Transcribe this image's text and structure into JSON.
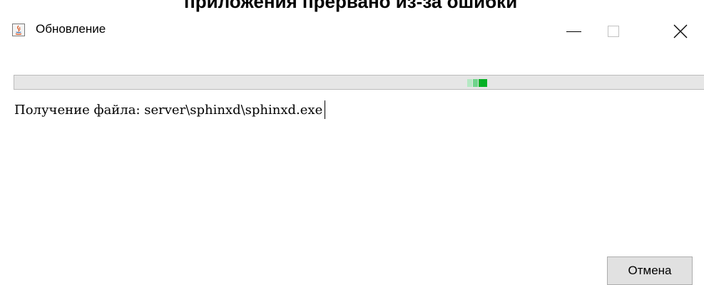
{
  "top_strip_text": "приложения прервано из-за ошибки",
  "window": {
    "title": "Обновление",
    "icon": "java-icon",
    "controls": [
      "minimize-icon",
      "maximize-icon",
      "close-icon"
    ]
  },
  "progress": {
    "indeterminate": true,
    "color": "#06b025"
  },
  "status": {
    "text": "Получение файла: server\\sphinxd\\sphinxd.exe"
  },
  "buttons": {
    "cancel_label": "Отмена"
  }
}
